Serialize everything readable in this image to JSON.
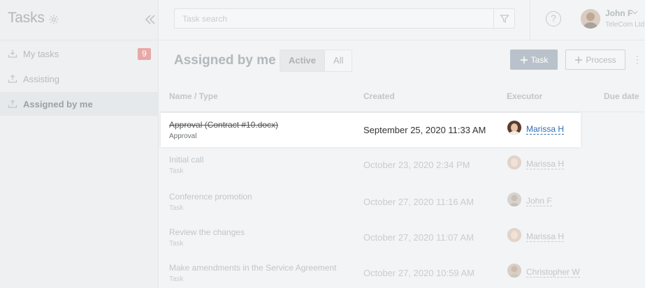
{
  "sidebar": {
    "title": "Tasks",
    "items": [
      {
        "label": "My tasks",
        "badge": "9",
        "icon": "inbox-icon"
      },
      {
        "label": "Assisting",
        "icon": "inbox-out-icon"
      },
      {
        "label": "Assigned by me",
        "icon": "inbox-up-icon",
        "active": true
      }
    ]
  },
  "header": {
    "search_placeholder": "Task search",
    "user_name": "John F",
    "user_company": "TeleCom Ltd"
  },
  "toolbar": {
    "page_title": "Assigned by me",
    "tabs": [
      {
        "label": "Active",
        "active": true
      },
      {
        "label": "All",
        "active": false
      }
    ],
    "task_button": "Task",
    "process_button": "Process"
  },
  "table": {
    "columns": [
      "Name / Type",
      "Created",
      "Executor",
      "Due date"
    ],
    "rows": [
      {
        "name": "Approval (Contract #10.docx)",
        "type": "Approval",
        "created": "September 25, 2020 11:33 AM",
        "executor": "Marissa H"
      },
      {
        "name": "Initial call",
        "type": "Task",
        "created": "October 23, 2020 2:34 PM",
        "executor": "Marissa H"
      },
      {
        "name": "Conference promotion",
        "type": "Task",
        "created": "October 27, 2020 11:16 AM",
        "executor": "John F"
      },
      {
        "name": "Review the changes",
        "type": "Task",
        "created": "October 27, 2020 11:07 AM",
        "executor": "Marissa H"
      },
      {
        "name": "Make amendments in the Service Agreement",
        "type": "Task",
        "created": "October 27, 2020 10:59 AM",
        "executor": "Christopher W"
      }
    ]
  },
  "colors": {
    "link_blue": "#2c6db4",
    "badge_red": "#e8a8a6",
    "primary_button": "#b9c2ca"
  }
}
